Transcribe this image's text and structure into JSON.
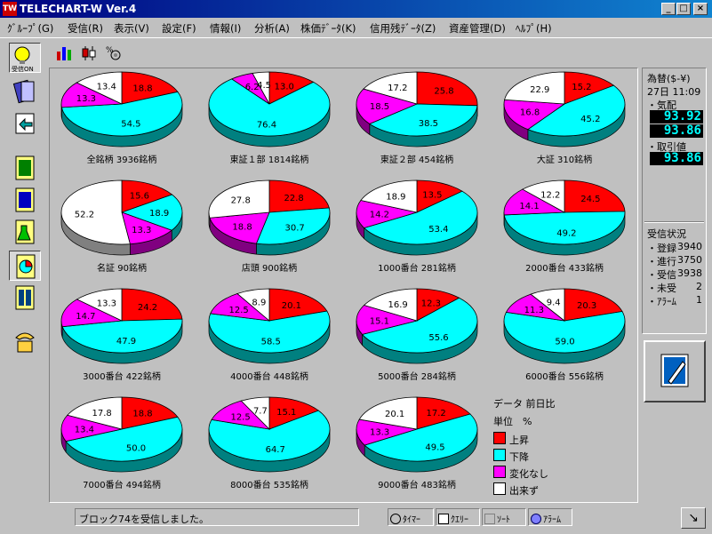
{
  "window": {
    "title": "TELECHART-W Ver.4",
    "app_icon_text": "TW",
    "minimize": "_",
    "maximize": "□",
    "close": "×"
  },
  "menu": [
    "ｸﾞﾙｰﾌﾟ(G)",
    "受信(R)",
    "表示(V)",
    "設定(F)",
    "情報(I)",
    "分析(A)",
    "株価ﾃﾞｰﾀ(K)",
    "信用残ﾃﾞｰﾀ(Z)",
    "資産管理(D)",
    "ﾍﾙﾌﾟ(H)"
  ],
  "toolbar": {
    "icons": [
      "bar-chart-icon",
      "candlestick-icon",
      "percent-network-icon"
    ]
  },
  "sidebar": {
    "icons": [
      "receive-on-icon",
      "bookmarks-icon",
      "refresh-folder-icon",
      "list-view-icon",
      "table-view-icon",
      "analysis-flask-icon",
      "pie-chart-icon",
      "book-icon",
      "telephone-icon"
    ],
    "receive_on_label": "受信ON"
  },
  "colors": {
    "up": "#ff0000",
    "down": "#00ffff",
    "unchanged": "#ff00ff",
    "not_traded": "#ffffff"
  },
  "chart_data": {
    "type": "pie",
    "series_order": [
      "上昇",
      "下降",
      "変化なし",
      "出来ず"
    ],
    "charts": [
      {
        "label": "全銘柄 3936銘柄",
        "values": [
          18.8,
          54.5,
          13.3,
          13.4
        ]
      },
      {
        "label": "東証１部 1814銘柄",
        "values": [
          13.0,
          76.4,
          6.2,
          4.5
        ]
      },
      {
        "label": "東証２部 454銘柄",
        "values": [
          25.8,
          38.5,
          18.5,
          17.2
        ]
      },
      {
        "label": "大証 310銘柄",
        "values": [
          15.2,
          45.2,
          16.8,
          22.9
        ]
      },
      {
        "label": "名証 90銘柄",
        "values": [
          15.6,
          18.9,
          13.3,
          52.2
        ]
      },
      {
        "label": "店頭 900銘柄",
        "values": [
          22.8,
          30.7,
          18.8,
          27.8
        ]
      },
      {
        "label": "1000番台 281銘柄",
        "values": [
          13.5,
          53.4,
          14.2,
          18.9
        ]
      },
      {
        "label": "2000番台 433銘柄",
        "values": [
          24.5,
          49.2,
          14.1,
          12.2
        ]
      },
      {
        "label": "3000番台 422銘柄",
        "values": [
          24.2,
          47.9,
          14.7,
          13.3
        ]
      },
      {
        "label": "4000番台 448銘柄",
        "values": [
          20.1,
          58.5,
          12.5,
          8.9
        ]
      },
      {
        "label": "5000番台 284銘柄",
        "values": [
          12.3,
          55.6,
          15.1,
          16.9
        ]
      },
      {
        "label": "6000番台 556銘柄",
        "values": [
          20.3,
          59.0,
          11.3,
          9.4
        ]
      },
      {
        "label": "7000番台 494銘柄",
        "values": [
          18.8,
          50.0,
          13.4,
          17.8
        ]
      },
      {
        "label": "8000番台 535銘柄",
        "values": [
          15.1,
          64.7,
          12.5,
          7.7
        ]
      },
      {
        "label": "9000番台 483銘柄",
        "values": [
          17.2,
          49.5,
          13.3,
          20.1
        ]
      }
    ]
  },
  "legend": {
    "title": "データ 前日比",
    "unit": "単位　%",
    "items": [
      "上昇",
      "下降",
      "変化なし",
      "出来ず"
    ]
  },
  "right_panel": {
    "fx_title": "為替($-¥)",
    "time": "27日 11:09",
    "quote_label": "・気配",
    "quote_bid": "93.92",
    "quote_ask": "93.86",
    "trade_label": "・取引値",
    "trade_value": "93.86",
    "status_title": "受信状況",
    "status": [
      {
        "label": "・登録",
        "value": "3940"
      },
      {
        "label": "・進行",
        "value": "3750"
      },
      {
        "label": "・受信",
        "value": "3938"
      },
      {
        "label": "・未受",
        "value": "2"
      },
      {
        "label": "・ｱﾗｰﾑ",
        "value": "1"
      }
    ]
  },
  "statusbar": {
    "message": "ブロック74を受信しました。",
    "timer": "ﾀｲﾏｰ",
    "query": "ｸｴﾘｰ",
    "sort": "ｿｰﾄ",
    "alarm": "ｱﾗｰﾑ"
  }
}
